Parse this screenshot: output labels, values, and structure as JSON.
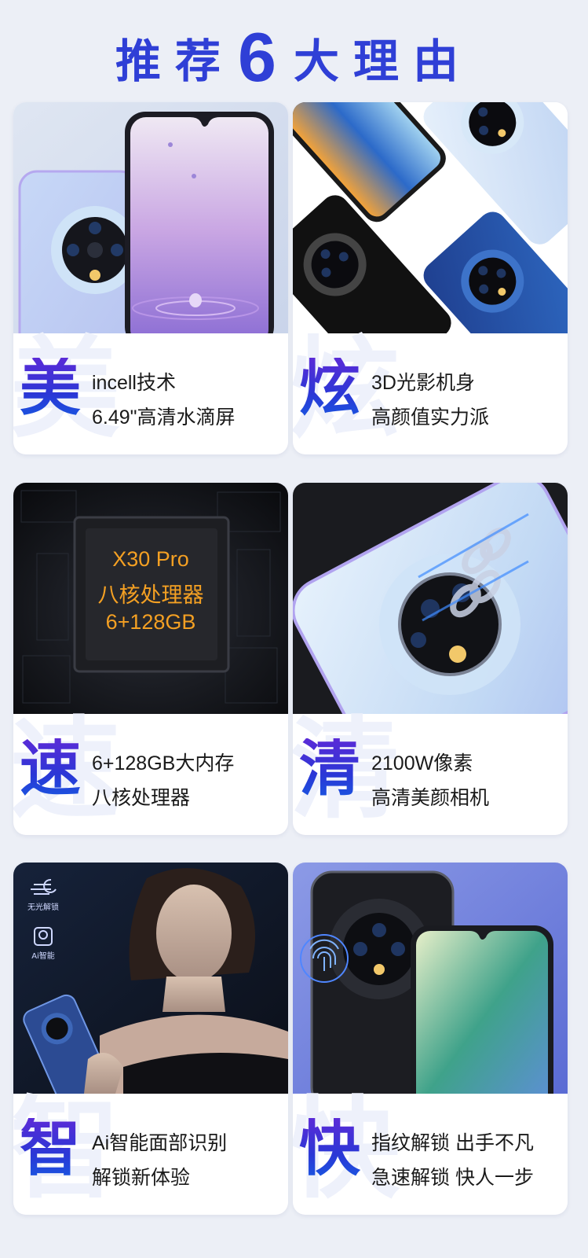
{
  "header": {
    "part1": "推荐",
    "number": "6",
    "part2": "大理由"
  },
  "cards": [
    {
      "char": "美",
      "line1": "incell技术",
      "line2": "6.49\"高清水滴屏"
    },
    {
      "char": "炫",
      "line1": "3D光影机身",
      "line2": "高颜值实力派"
    },
    {
      "char": "速",
      "line1": "6+128GB大内存",
      "line2": "八核处理器",
      "chip": {
        "l1": "X30 Pro",
        "l2": "八核处理器",
        "l3": "6+128GB"
      }
    },
    {
      "char": "清",
      "line1": "2100W像素",
      "line2": "高清美颜相机"
    },
    {
      "char": "智",
      "line1": "Ai智能面部识别",
      "line2": "解锁新体验",
      "tags": {
        "t1": "无光解锁",
        "t2": "Ai智能"
      }
    },
    {
      "char": "快",
      "line1": "指纹解锁 出手不凡",
      "line2": "急速解锁 快人一步"
    }
  ],
  "colors": {
    "title": "#2f3fd6",
    "accent_start": "#5b2bd7",
    "accent_end": "#1a56e0",
    "chip_text": "#f4a023",
    "bg": "#eceff6"
  }
}
